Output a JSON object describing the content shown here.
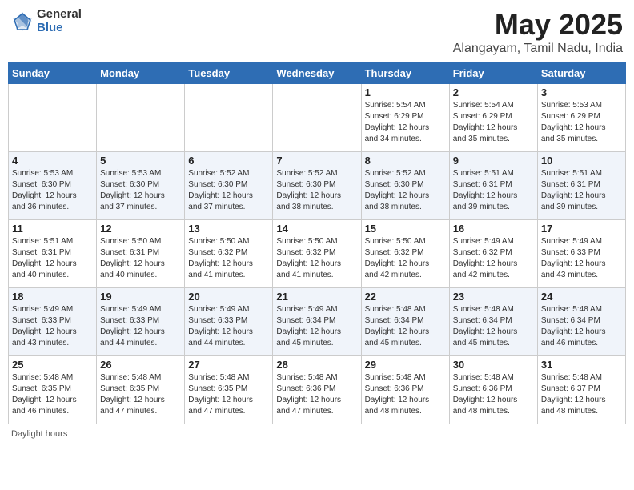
{
  "header": {
    "logo_general": "General",
    "logo_blue": "Blue",
    "title": "May 2025",
    "location": "Alangayam, Tamil Nadu, India"
  },
  "days_of_week": [
    "Sunday",
    "Monday",
    "Tuesday",
    "Wednesday",
    "Thursday",
    "Friday",
    "Saturday"
  ],
  "weeks": [
    [
      {
        "day": "",
        "text": ""
      },
      {
        "day": "",
        "text": ""
      },
      {
        "day": "",
        "text": ""
      },
      {
        "day": "",
        "text": ""
      },
      {
        "day": "1",
        "text": "Sunrise: 5:54 AM\nSunset: 6:29 PM\nDaylight: 12 hours\nand 34 minutes."
      },
      {
        "day": "2",
        "text": "Sunrise: 5:54 AM\nSunset: 6:29 PM\nDaylight: 12 hours\nand 35 minutes."
      },
      {
        "day": "3",
        "text": "Sunrise: 5:53 AM\nSunset: 6:29 PM\nDaylight: 12 hours\nand 35 minutes."
      }
    ],
    [
      {
        "day": "4",
        "text": "Sunrise: 5:53 AM\nSunset: 6:30 PM\nDaylight: 12 hours\nand 36 minutes."
      },
      {
        "day": "5",
        "text": "Sunrise: 5:53 AM\nSunset: 6:30 PM\nDaylight: 12 hours\nand 37 minutes."
      },
      {
        "day": "6",
        "text": "Sunrise: 5:52 AM\nSunset: 6:30 PM\nDaylight: 12 hours\nand 37 minutes."
      },
      {
        "day": "7",
        "text": "Sunrise: 5:52 AM\nSunset: 6:30 PM\nDaylight: 12 hours\nand 38 minutes."
      },
      {
        "day": "8",
        "text": "Sunrise: 5:52 AM\nSunset: 6:30 PM\nDaylight: 12 hours\nand 38 minutes."
      },
      {
        "day": "9",
        "text": "Sunrise: 5:51 AM\nSunset: 6:31 PM\nDaylight: 12 hours\nand 39 minutes."
      },
      {
        "day": "10",
        "text": "Sunrise: 5:51 AM\nSunset: 6:31 PM\nDaylight: 12 hours\nand 39 minutes."
      }
    ],
    [
      {
        "day": "11",
        "text": "Sunrise: 5:51 AM\nSunset: 6:31 PM\nDaylight: 12 hours\nand 40 minutes."
      },
      {
        "day": "12",
        "text": "Sunrise: 5:50 AM\nSunset: 6:31 PM\nDaylight: 12 hours\nand 40 minutes."
      },
      {
        "day": "13",
        "text": "Sunrise: 5:50 AM\nSunset: 6:32 PM\nDaylight: 12 hours\nand 41 minutes."
      },
      {
        "day": "14",
        "text": "Sunrise: 5:50 AM\nSunset: 6:32 PM\nDaylight: 12 hours\nand 41 minutes."
      },
      {
        "day": "15",
        "text": "Sunrise: 5:50 AM\nSunset: 6:32 PM\nDaylight: 12 hours\nand 42 minutes."
      },
      {
        "day": "16",
        "text": "Sunrise: 5:49 AM\nSunset: 6:32 PM\nDaylight: 12 hours\nand 42 minutes."
      },
      {
        "day": "17",
        "text": "Sunrise: 5:49 AM\nSunset: 6:33 PM\nDaylight: 12 hours\nand 43 minutes."
      }
    ],
    [
      {
        "day": "18",
        "text": "Sunrise: 5:49 AM\nSunset: 6:33 PM\nDaylight: 12 hours\nand 43 minutes."
      },
      {
        "day": "19",
        "text": "Sunrise: 5:49 AM\nSunset: 6:33 PM\nDaylight: 12 hours\nand 44 minutes."
      },
      {
        "day": "20",
        "text": "Sunrise: 5:49 AM\nSunset: 6:33 PM\nDaylight: 12 hours\nand 44 minutes."
      },
      {
        "day": "21",
        "text": "Sunrise: 5:49 AM\nSunset: 6:34 PM\nDaylight: 12 hours\nand 45 minutes."
      },
      {
        "day": "22",
        "text": "Sunrise: 5:48 AM\nSunset: 6:34 PM\nDaylight: 12 hours\nand 45 minutes."
      },
      {
        "day": "23",
        "text": "Sunrise: 5:48 AM\nSunset: 6:34 PM\nDaylight: 12 hours\nand 45 minutes."
      },
      {
        "day": "24",
        "text": "Sunrise: 5:48 AM\nSunset: 6:34 PM\nDaylight: 12 hours\nand 46 minutes."
      }
    ],
    [
      {
        "day": "25",
        "text": "Sunrise: 5:48 AM\nSunset: 6:35 PM\nDaylight: 12 hours\nand 46 minutes."
      },
      {
        "day": "26",
        "text": "Sunrise: 5:48 AM\nSunset: 6:35 PM\nDaylight: 12 hours\nand 47 minutes."
      },
      {
        "day": "27",
        "text": "Sunrise: 5:48 AM\nSunset: 6:35 PM\nDaylight: 12 hours\nand 47 minutes."
      },
      {
        "day": "28",
        "text": "Sunrise: 5:48 AM\nSunset: 6:36 PM\nDaylight: 12 hours\nand 47 minutes."
      },
      {
        "day": "29",
        "text": "Sunrise: 5:48 AM\nSunset: 6:36 PM\nDaylight: 12 hours\nand 48 minutes."
      },
      {
        "day": "30",
        "text": "Sunrise: 5:48 AM\nSunset: 6:36 PM\nDaylight: 12 hours\nand 48 minutes."
      },
      {
        "day": "31",
        "text": "Sunrise: 5:48 AM\nSunset: 6:37 PM\nDaylight: 12 hours\nand 48 minutes."
      }
    ]
  ],
  "footer": "Daylight hours"
}
